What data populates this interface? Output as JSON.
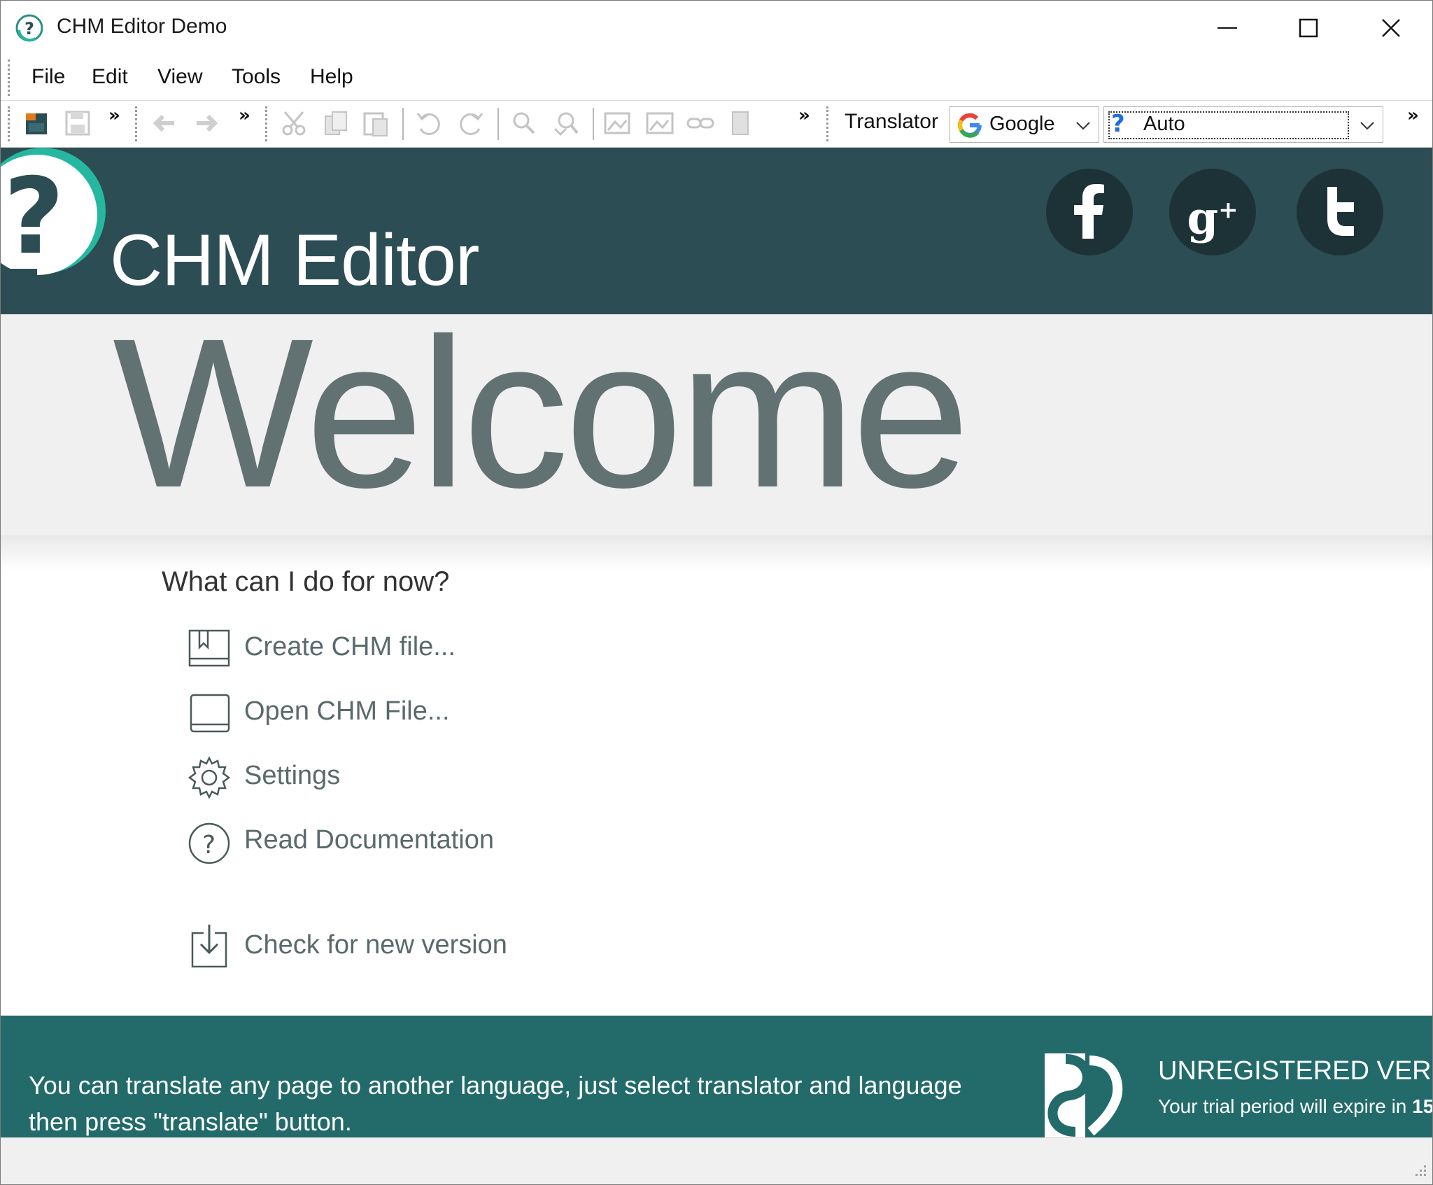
{
  "window": {
    "title": "CHM Editor Demo",
    "minimize_label": "Minimize",
    "maximize_label": "Maximize",
    "close_label": "Close"
  },
  "menu": {
    "items": [
      {
        "label": "File"
      },
      {
        "label": "Edit"
      },
      {
        "label": "View"
      },
      {
        "label": "Tools"
      },
      {
        "label": "Help"
      }
    ]
  },
  "toolbar": {
    "overflow": "»",
    "translator_label": "Translator",
    "translator_engine": "Google",
    "language": "Auto",
    "icons": [
      "new-chm-icon",
      "save-icon",
      "back-icon",
      "forward-icon",
      "cut-icon",
      "copy-icon",
      "paste-icon",
      "undo-icon",
      "redo-icon",
      "find-icon",
      "find-replace-icon",
      "insert-image-icon",
      "image-icon",
      "link-icon",
      "bookmark-icon"
    ]
  },
  "header": {
    "app_name": "CHM Editor",
    "social": [
      {
        "name": "facebook-icon",
        "glyph": "f"
      },
      {
        "name": "google-plus-icon",
        "glyph": "g⁺"
      },
      {
        "name": "twitter-icon",
        "glyph": "t"
      }
    ]
  },
  "welcome": {
    "heading": "Welcome",
    "question": "What can I do for now?",
    "actions": [
      {
        "label": "Create CHM file..."
      },
      {
        "label": "Open CHM File..."
      },
      {
        "label": "Settings"
      },
      {
        "label": "Read Documentation"
      },
      {
        "label": "Check for new version"
      }
    ]
  },
  "footer": {
    "message": "You can translate any page to another language, just select translator and language then press \"translate\" button.",
    "unregistered_title": "UNREGISTERED VERSIO",
    "trial_text": "Your trial period will expire in",
    "trial_days": "15"
  },
  "colors": {
    "banner": "#2c4d53",
    "footer": "#236b6b",
    "welcome_text": "#627272",
    "accent": "#26b7a0"
  }
}
